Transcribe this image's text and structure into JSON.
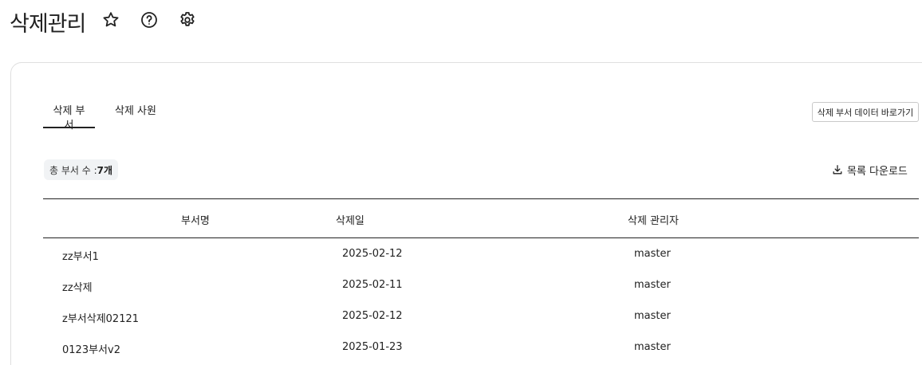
{
  "header": {
    "title": "삭제관리",
    "icons": [
      "star-icon",
      "help-icon",
      "gear-icon"
    ]
  },
  "tabs": [
    {
      "label": "삭제 부서",
      "active": true
    },
    {
      "label": "삭제 사원",
      "active": false
    }
  ],
  "shortcut_button": "삭제 부서 데이터 바로가기",
  "summary": {
    "label": "총 부서 수 : ",
    "count": "7개"
  },
  "download_button": "목록 다운로드",
  "table": {
    "columns": [
      "부서명",
      "삭제일",
      "삭제 관리자"
    ],
    "rows": [
      [
        "zz부서1",
        "2025-02-12",
        "master"
      ],
      [
        "zz삭제",
        "2025-02-11",
        "master"
      ],
      [
        "z부서삭제02121",
        "2025-02-12",
        "master"
      ],
      [
        "0123부서v2",
        "2025-01-23",
        "master"
      ]
    ]
  },
  "colors": {
    "text": "#222222",
    "border": "#dfdfdf",
    "badge_bg": "#f1f3f5"
  }
}
